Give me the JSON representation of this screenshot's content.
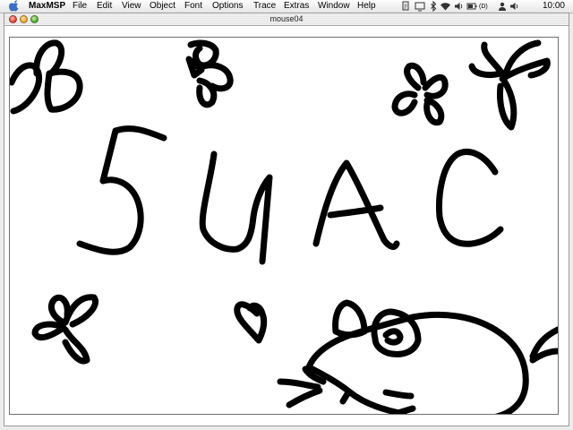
{
  "menubar": {
    "apple_icon": "apple-icon",
    "app_name": "MaxMSP",
    "items": [
      "File",
      "Edit",
      "View",
      "Object",
      "Font",
      "Options",
      "Trace",
      "Extras",
      "Window",
      "Help"
    ],
    "status_icons": [
      "script-menu-icon",
      "display-icon",
      "bluetooth-icon",
      "wifi-icon",
      "volume-icon",
      "battery-icon"
    ],
    "battery_text": "(D)",
    "clock": "10:00"
  },
  "window": {
    "title": "mouse04",
    "canvas": {
      "background": "#ffffff",
      "stroke_color": "#000000",
      "drawn_text": "5UAC",
      "drawings": [
        "flower",
        "flower",
        "flower",
        "flower",
        "flower",
        "heart",
        "mouse"
      ]
    }
  },
  "colors": {
    "close": "#e0402f",
    "minimize": "#e0a22a",
    "zoom": "#4da72d"
  }
}
